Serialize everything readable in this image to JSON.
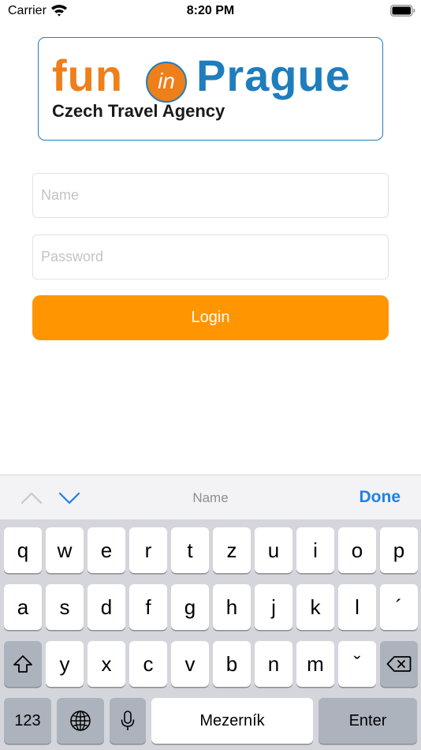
{
  "status_bar": {
    "carrier": "Carrier",
    "time": "8:20 PM"
  },
  "logo": {
    "word_fun": "fun",
    "word_in": "in",
    "word_prague": "Prague",
    "tagline": "Czech Travel Agency",
    "colors": {
      "orange": "#ef7f1a",
      "blue": "#1f7dbd"
    }
  },
  "form": {
    "name_placeholder": "Name",
    "password_placeholder": "Password",
    "login_label": "Login",
    "accent": "#ff9500"
  },
  "accessory_bar": {
    "field_label": "Name",
    "done_label": "Done"
  },
  "keyboard": {
    "row1": [
      "q",
      "w",
      "e",
      "r",
      "t",
      "z",
      "u",
      "i",
      "o",
      "p"
    ],
    "row2": [
      "a",
      "s",
      "d",
      "f",
      "g",
      "h",
      "j",
      "k",
      "l",
      "´"
    ],
    "row3": [
      "y",
      "x",
      "c",
      "v",
      "b",
      "n",
      "m",
      "ˇ"
    ],
    "numbers_label": "123",
    "space_label": "Mezerník",
    "enter_label": "Enter",
    "shift_icon": "shift-icon",
    "delete_icon": "delete-icon",
    "globe_icon": "globe-icon",
    "mic_icon": "microphone-icon"
  }
}
